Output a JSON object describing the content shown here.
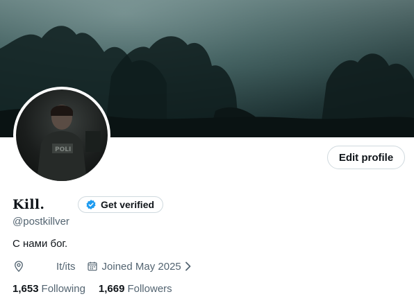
{
  "profile": {
    "display_name": "Kill.",
    "handle": "@postkillver",
    "bio": "С нами бог.",
    "location": "",
    "pronouns": "It/its",
    "joined": "Joined May 2025",
    "following_count": "1,653",
    "following_label": "Following",
    "followers_count": "1,669",
    "followers_label": "Followers"
  },
  "actions": {
    "edit_profile_label": "Edit profile",
    "get_verified_label": "Get verified"
  },
  "icons": {
    "verified": "verified-badge-icon",
    "location": "location-pin-icon",
    "calendar": "calendar-icon",
    "chevron": "chevron-right-icon"
  },
  "colors": {
    "accent": "#1d9bf0",
    "text": "#0f1419",
    "muted": "#536471",
    "border": "#cfd9de"
  }
}
